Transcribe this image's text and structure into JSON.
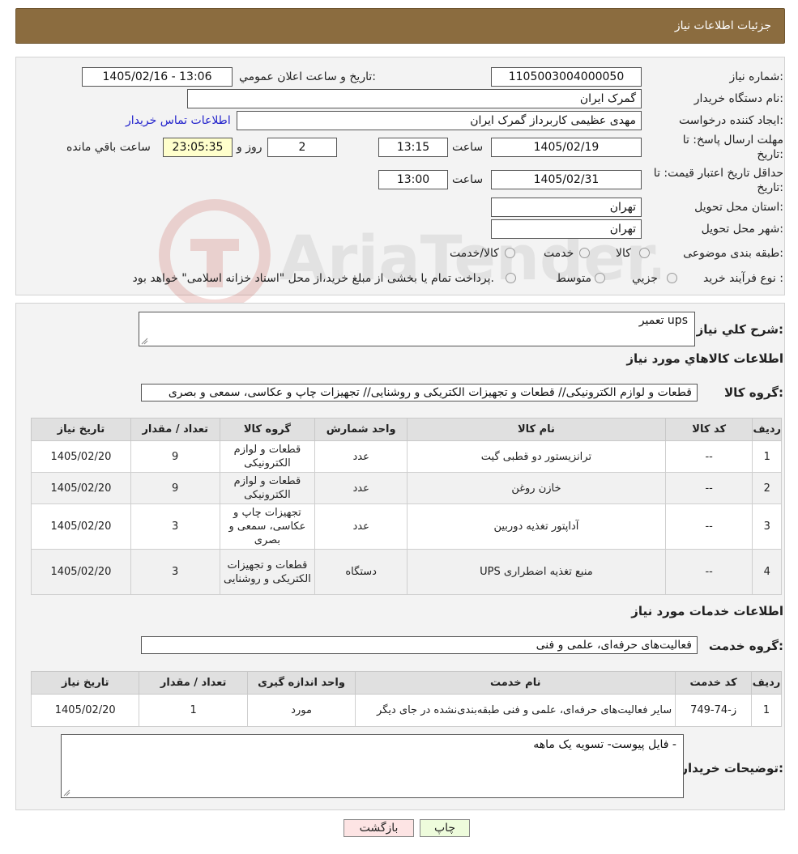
{
  "header": {
    "title": "جزئیات اطلاعات نیاز"
  },
  "form": {
    "need_number_label": "شماره نیاز:",
    "need_number": "1105003004000050",
    "announce_label": "تاریخ و ساعت اعلان عمومي:",
    "announce_value": "1405/02/16 - 13:06",
    "buyer_org_label": "نام دستگاه خریدار:",
    "buyer_org": "گمرک ایران",
    "creator_label": "ایجاد کننده درخواست:",
    "creator": "مهدی عظیمی کاربرداز گمرک ایران",
    "contact_link": "اطلاعات تماس خریدار",
    "deadline_label_1": "مهلت ارسال پاسخ: تا",
    "deadline_label_2": "تاریخ:",
    "deadline_date": "1405/02/19",
    "time_label": "ساعت",
    "deadline_time": "13:15",
    "days_value": "2",
    "days_label": "روز و",
    "remaining_value": "23:05:35",
    "remaining_label": "ساعت باقي مانده",
    "validity_label_1": "حداقل تاریخ اعتبار قیمت: تا",
    "validity_label_2": "تاریخ:",
    "validity_date": "1405/02/31",
    "validity_time": "13:00",
    "province_label": "استان محل تحویل:",
    "province": "تهران",
    "city_label": "شهر محل تحویل:",
    "city": "تهران",
    "category_label": "طبقه بندی موضوعی:",
    "category_options": [
      "کالا",
      "خدمت",
      "کالا/خدمت"
    ],
    "process_label": "نوع فرآیند خرید :",
    "process_options": [
      "جزیي",
      "متوسط"
    ],
    "process_note": "پرداخت تمام یا بخشی از مبلغ خرید،از محل \"اسناد خزانه اسلامی\" خواهد بود."
  },
  "description": {
    "label": "شرح كلي نياز:",
    "value": "تعمیر ups"
  },
  "goods": {
    "section_title": "اطلاعات کالاهاي مورد نياز",
    "group_label": "گروه کالا:",
    "group_value": "قطعات و لوازم الکترونیکی// قطعات و تجهیزات الکتریکی و روشنایی// تجهیزات چاپ و عکاسی، سمعی و بصری",
    "columns": [
      "رديف",
      "کد کالا",
      "نام کالا",
      "واحد شمارش",
      "گروه کالا",
      "تعداد / مقدار",
      "تاریخ نیاز"
    ],
    "rows": [
      {
        "idx": "1",
        "code": "--",
        "name": "ترانزیستور دو قطبی گیت",
        "unit": "عدد",
        "group": "قطعات و لوازم الکترونیکی",
        "qty": "9",
        "date": "1405/02/20"
      },
      {
        "idx": "2",
        "code": "--",
        "name": "خازن روغن",
        "unit": "عدد",
        "group": "قطعات و لوازم الکترونیکی",
        "qty": "9",
        "date": "1405/02/20"
      },
      {
        "idx": "3",
        "code": "--",
        "name": "آداپتور تغذیه دوربین",
        "unit": "عدد",
        "group": "تجهیزات چاپ و عکاسی، سمعی و بصری",
        "qty": "3",
        "date": "1405/02/20"
      },
      {
        "idx": "4",
        "code": "--",
        "name": "منبع تغذیه اضطراری UPS",
        "unit": "دستگاه",
        "group": "قطعات و تجهیزات الکتریکی و روشنایی",
        "qty": "3",
        "date": "1405/02/20"
      }
    ]
  },
  "services": {
    "section_title": "اطلاعات خدمات مورد نياز",
    "group_label": "گروه خدمت:",
    "group_value": "فعالیت‌های حرفه‌ای، علمی و فنی",
    "columns": [
      "رديف",
      "کد خدمت",
      "نام خدمت",
      "واحد اندازه گیری",
      "تعداد / مقدار",
      "تاریخ نیاز"
    ],
    "rows": [
      {
        "idx": "1",
        "code": "ز-74-749",
        "name": "سایر فعالیت‌های حرفه‌ای، علمی و فنی طبقه‌بندی‌نشده در جای دیگر",
        "unit": "مورد",
        "qty": "1",
        "date": "1405/02/20"
      }
    ]
  },
  "buyer_notes": {
    "label": "توضیحات خریدار:",
    "value": "فایل پیوست- تسویه یک ماهه -"
  },
  "buttons": {
    "print": "چاپ",
    "back": "بازگشت"
  },
  "colors": {
    "header": "#8b6c3f",
    "print_btn": "#eefcdc",
    "back_btn": "#fde4e4"
  }
}
